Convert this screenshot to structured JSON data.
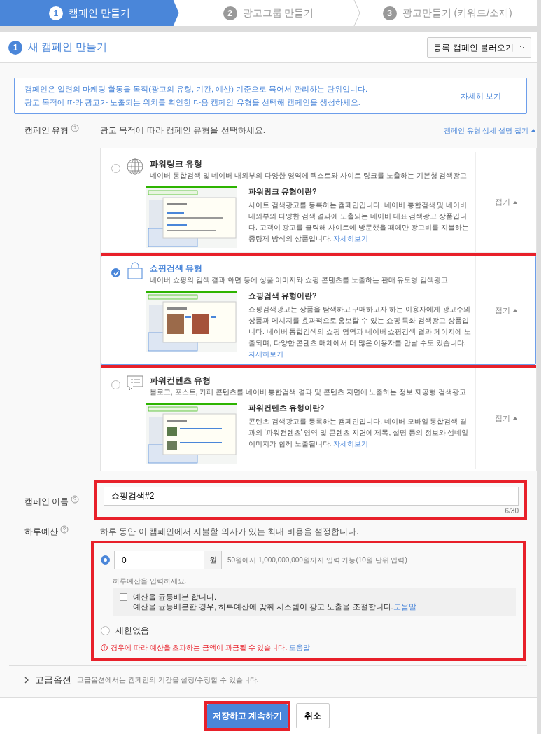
{
  "steps": [
    {
      "number": "1",
      "label": "캠페인 만들기",
      "selected": true
    },
    {
      "number": "2",
      "label": "광고그룹 만들기",
      "selected": false
    },
    {
      "number": "3",
      "label": "광고만들기 (키워드/소재)",
      "selected": false
    }
  ],
  "panel": {
    "number": "1",
    "title": "새 캠페인 만들기",
    "load_button": "등록 캠페인 불러오기"
  },
  "info": {
    "lines": [
      "캠페인은 일련의 마케팅 활동을 목적(광고의 유형, 기간, 예산) 기준으로 묶어서 관리하는 단위입니다.",
      "광고 목적에 따라 광고가 노출되는 위치를 확인한 다음 캠페인 유형을 선택해 캠페인을 생성하세요."
    ],
    "link": "자세히 보기"
  },
  "campaign_type": {
    "label": "캠페인 유형",
    "description": "광고 목적에 따라 캠페인 유형을 선택하세요.",
    "toggle": "캠페인 유형 상세 설명 접기",
    "types": [
      {
        "title": "파워링크 유형",
        "subtitle": "네이버 통합검색 및 네이버 내외부의 다양한 영역에 텍스트와 사이트 링크를 노출하는 기본형 검색광고",
        "selected": false,
        "highlighted": false,
        "detail_title": "파워링크 유형이란?",
        "detail_text": "사이트 검색광고를 등록하는 캠페인입니다. 네이버 통합검색 및 네이버 내외부의 다양한 검색 결과에 노출되는 네이버 대표 검색광고 상품입니다. 고객이 광고를 클릭해 사이트에 방문했을 때에만 광고비를 지불하는 종량제 방식의 상품입니다.",
        "detail_link": "자세히보기",
        "collapse": "접기"
      },
      {
        "title": "쇼핑검색 유형",
        "subtitle": "네이버 쇼핑의 검색 결과 화면 등에 상품 이미지와 쇼핑 콘텐츠를 노출하는 판매 유도형 검색광고",
        "selected": true,
        "highlighted": true,
        "detail_title": "쇼핑검색 유형이란?",
        "detail_text": "쇼핑검색광고는 상품을 탐색하고 구매하고자 하는 이용자에게 광고주의 상품과 메시지를 효과적으로 홍보할 수 있는 쇼핑 특화 검색광고 상품입니다. 네이버 통합검색의 쇼핑 영역과 네이버 쇼핑검색 결과 페이지에 노출되며, 다양한 콘텐츠 매체에서 더 많은 이용자를 만날 수도 있습니다.",
        "detail_link": "자세히보기",
        "collapse": "접기"
      },
      {
        "title": "파워컨텐츠 유형",
        "subtitle": "블로그, 포스트, 카페 콘텐츠를 네이버 통합검색 결과 및 콘텐츠 지면에 노출하는 정보 제공형 검색광고",
        "selected": false,
        "highlighted": false,
        "detail_title": "파워컨텐츠 유형이란?",
        "detail_text": "콘텐츠 검색광고를 등록하는 캠페인입니다. 네이버 모바일 통합검색 결과의 '파워컨텐츠' 영역 및 콘텐츠 지면에 제목, 설명 등의 정보와 섬네일 이미지가 함께 노출됩니다.",
        "detail_link": "자세히보기",
        "collapse": "접기"
      }
    ]
  },
  "campaign_name": {
    "label": "캠페인 이름",
    "value": "쇼핑검색#2",
    "counter": "6/30",
    "highlighted": true
  },
  "budget": {
    "label": "하루예산",
    "description": "하루 동안 이 캠페인에서 지불할 의사가 있는 최대 비용을 설정합니다.",
    "highlighted": true,
    "amount": {
      "selected": true,
      "value": "0",
      "unit": "원",
      "range": "50원에서 1,000,000,000원까지 입력 가능(10원 단위 입력)",
      "hint": "하루예산을 입력하세요."
    },
    "even": {
      "checked": false,
      "label": "예산을 균등배분 합니다.",
      "note": "예산을 균등배분한 경우, 하루예산에 맞춰 시스템이 광고 노출을 조절합니다.",
      "link": "도움말"
    },
    "unlimited": {
      "selected": false,
      "label": "제한없음"
    },
    "warning": {
      "text": "경우에 따라 예산을 초과하는 금액이 과금될 수 있습니다.",
      "link": "도움말"
    }
  },
  "advanced": {
    "label": "고급옵션",
    "description": "고급옵션에서는 캠페인의 기간을 설정/수정할 수 있습니다.",
    "expanded": false
  },
  "buttons": [
    {
      "kind": "primary",
      "label": "저장하고 계속하기",
      "highlighted": true
    },
    {
      "kind": "secondary",
      "label": "취소",
      "highlighted": false
    }
  ]
}
